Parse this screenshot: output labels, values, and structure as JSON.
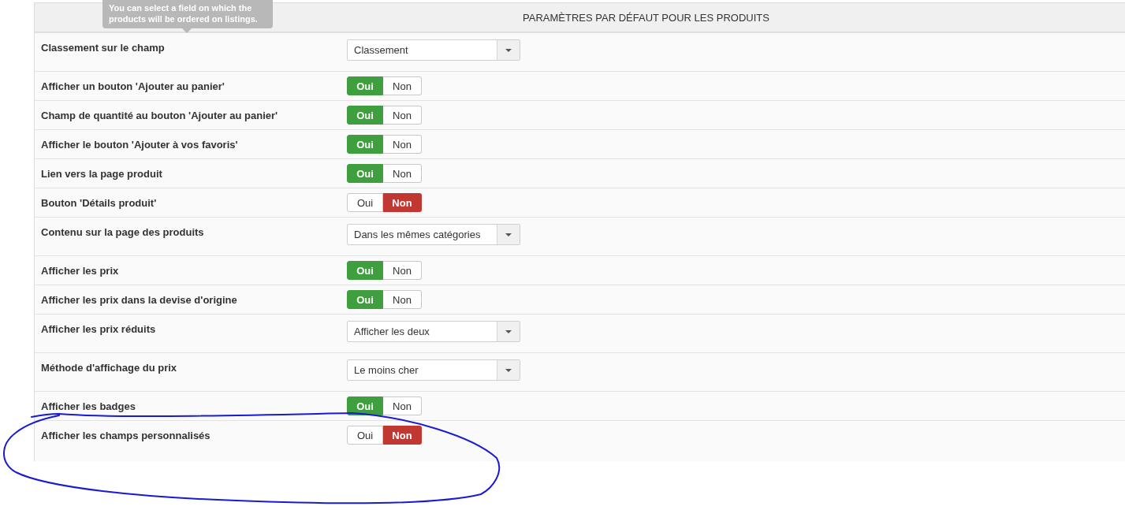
{
  "tooltip": {
    "text": "You can select a field on which the products will be ordered on listings."
  },
  "panel": {
    "title": "PARAMÈTRES PAR DÉFAUT POUR LES PRODUITS"
  },
  "rows": [
    {
      "label": "Classement sur le champ",
      "control": {
        "kind": "select",
        "value": "Classement"
      },
      "circled": false
    },
    {
      "label": "Afficher un bouton 'Ajouter au panier'",
      "control": {
        "kind": "toggle",
        "options": [
          {
            "label": "Oui",
            "selected": true
          },
          {
            "label": "Non",
            "selected": false
          }
        ]
      },
      "circled": false
    },
    {
      "label": "Champ de quantité au bouton 'Ajouter au panier'",
      "control": {
        "kind": "toggle",
        "options": [
          {
            "label": "Oui",
            "selected": true
          },
          {
            "label": "Non",
            "selected": false
          }
        ]
      },
      "circled": false
    },
    {
      "label": "Afficher le bouton 'Ajouter à vos favoris'",
      "control": {
        "kind": "toggle",
        "options": [
          {
            "label": "Oui",
            "selected": true
          },
          {
            "label": "Non",
            "selected": false
          }
        ]
      },
      "circled": false
    },
    {
      "label": "Lien vers la page produit",
      "control": {
        "kind": "toggle",
        "options": [
          {
            "label": "Oui",
            "selected": true
          },
          {
            "label": "Non",
            "selected": false
          }
        ]
      },
      "circled": false
    },
    {
      "label": "Bouton 'Détails produit'",
      "control": {
        "kind": "toggle",
        "options": [
          {
            "label": "Oui",
            "selected": false
          },
          {
            "label": "Non",
            "selected": true
          }
        ]
      },
      "circled": false
    },
    {
      "label": "Contenu sur la page des produits",
      "control": {
        "kind": "select",
        "value": "Dans les mêmes catégories"
      },
      "circled": false
    },
    {
      "label": "Afficher les prix",
      "control": {
        "kind": "toggle",
        "options": [
          {
            "label": "Oui",
            "selected": true
          },
          {
            "label": "Non",
            "selected": false
          }
        ]
      },
      "circled": false
    },
    {
      "label": "Afficher les prix dans la devise d'origine",
      "control": {
        "kind": "toggle",
        "options": [
          {
            "label": "Oui",
            "selected": true
          },
          {
            "label": "Non",
            "selected": false
          }
        ]
      },
      "circled": false
    },
    {
      "label": "Afficher les prix réduits",
      "control": {
        "kind": "select",
        "value": "Afficher les deux"
      },
      "circled": false
    },
    {
      "label": "Méthode d'affichage du prix",
      "control": {
        "kind": "select",
        "value": "Le moins cher"
      },
      "circled": false
    },
    {
      "label": "Afficher les badges",
      "control": {
        "kind": "toggle",
        "options": [
          {
            "label": "Oui",
            "selected": true
          },
          {
            "label": "Non",
            "selected": false
          }
        ]
      },
      "circled": false
    },
    {
      "label": "Afficher les champs personnalisés",
      "control": {
        "kind": "toggle",
        "options": [
          {
            "label": "Oui",
            "selected": false
          },
          {
            "label": "Non",
            "selected": true
          }
        ]
      },
      "circled": true
    }
  ]
}
